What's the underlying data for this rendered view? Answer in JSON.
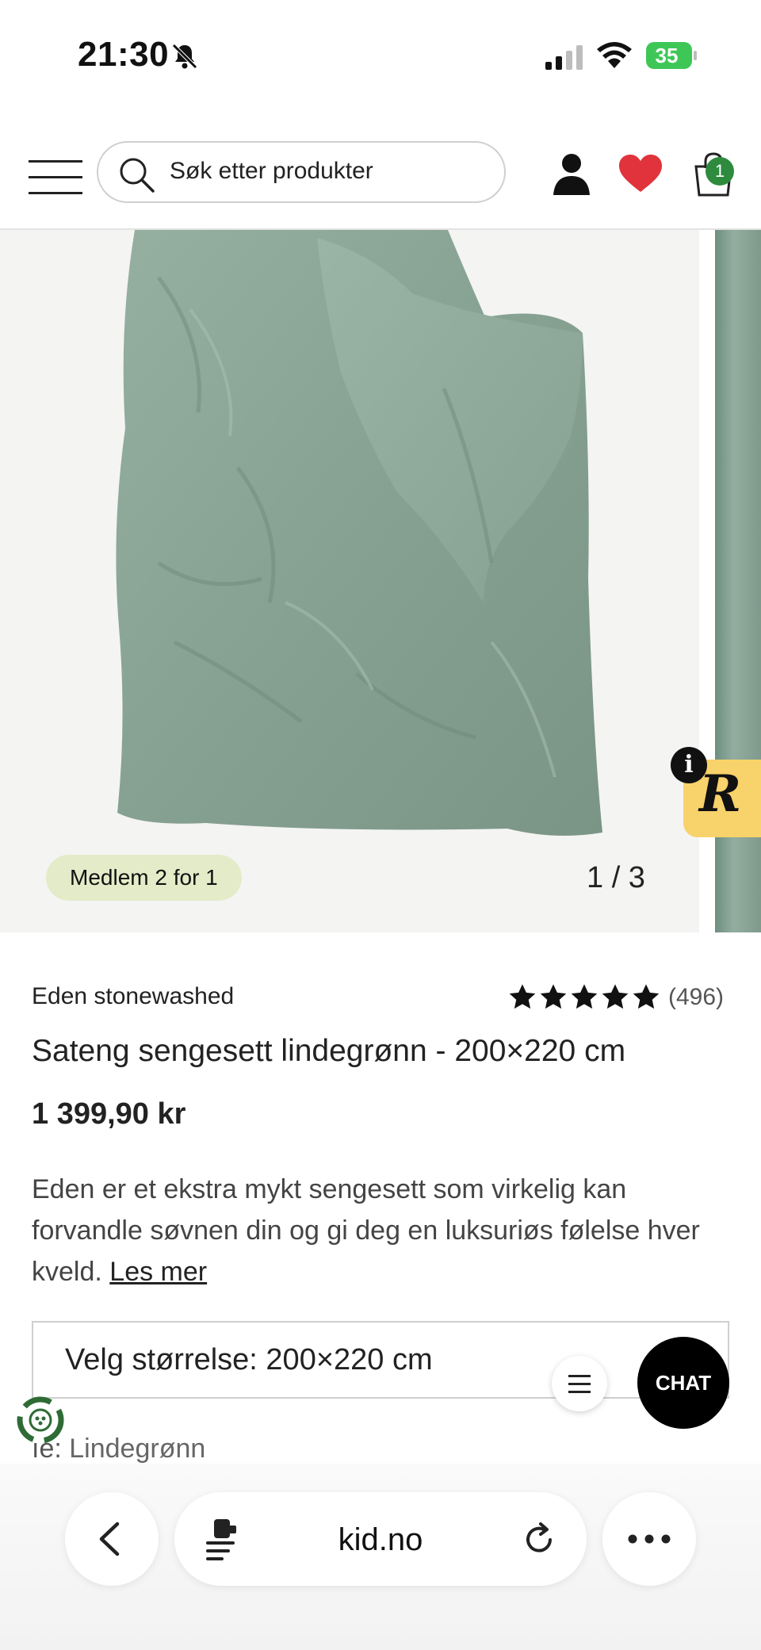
{
  "status_bar": {
    "time": "21:30",
    "battery": "35"
  },
  "header": {
    "search_placeholder": "Søk etter produkter",
    "cart_count": "1"
  },
  "gallery": {
    "member_badge": "Medlem 2 for 1",
    "counter": "1 / 3"
  },
  "product": {
    "brand": "Eden stonewashed",
    "rating_stars": 5,
    "rating_count": "(496)",
    "title": "Sateng sengesett lindegrønn - 200×220 cm",
    "price": "1 399,90 kr",
    "description": "Eden er et ekstra mykt sengesett som virkelig kan forvandle søvnen din og gi deg en luksuriøs følelse hver kveld.",
    "read_more": "Les mer",
    "size_select": "Velg størrelse: 200×220 cm",
    "color_label": "ıe:",
    "color_value": "Lindegrønn"
  },
  "chat": {
    "label": "CHAT"
  },
  "browser": {
    "url": "kid.no"
  },
  "colors": {
    "accent_green": "#2e8b3e",
    "heart_red": "#e0333b",
    "member_badge_bg": "#e4ebc8",
    "review_widget": "#f8d26a",
    "duvet_green": "#8aa596"
  }
}
